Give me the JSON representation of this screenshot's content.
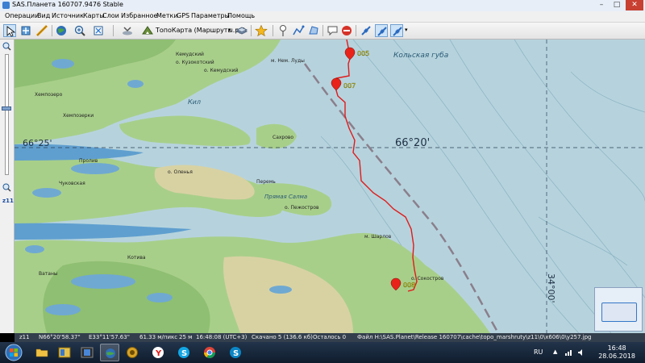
{
  "window": {
    "title": "SAS.Планета 160707.9476 Stable"
  },
  "menu": [
    "Операции",
    "Вид",
    "Источник",
    "Карты",
    "Слои",
    "Избранное",
    "Метки",
    "GPS",
    "Параметры",
    "Помощь"
  ],
  "toolbar": {
    "map_source": "ТопоКарта (Маршруты.ру)"
  },
  "zoom": {
    "label": "z11",
    "level_fraction": 0.45
  },
  "map": {
    "grid_labels": [
      "66°25'",
      "66°20'"
    ],
    "vertical_grid_label": "34°00'",
    "markers": [
      {
        "id": "005",
        "label": "005"
      },
      {
        "id": "007",
        "label": "007"
      },
      {
        "id": "008",
        "label": "008"
      }
    ],
    "place_names": [
      "Кемудский",
      "о. Кузокотский",
      "м. Нем. Луды",
      "Сахрово",
      "о. Кемудский",
      "Кольская губа",
      "Хемпозерки",
      "Пролив",
      "Чуковская",
      "о. Оленья",
      "Прямая Салма",
      "Перемь",
      "о. Пежостров",
      "м. Шарлов",
      "о. Сокостров",
      "Ватаны",
      "Котива",
      "Хемпозеро",
      "Кил"
    ]
  },
  "status": {
    "zoom": "z11",
    "lat": "N66°20'58.37\"",
    "lon": "E33°11'57.63\"",
    "scale": "61.33 м/пикс",
    "dist": "25 м",
    "time": "16:48:08 (UTC+3)",
    "downloaded": "Скачано 5 (136.6 кб)",
    "remaining": "Осталось 0",
    "file": "Файл H:\\SAS.Planet\\Release 160707\\cache\\topo_marshruty\\z11\\0\\x606\\0\\y257.jpg"
  },
  "taskbar": {
    "apps": [
      "explorer",
      "file-manager",
      "media-player",
      "sas-planeta",
      "yandex-browser",
      "skype",
      "chrome",
      "skype-2"
    ],
    "lang": "RU",
    "time": "16:48",
    "date": "28.06.2018"
  },
  "colors": {
    "water": "#b6d3dd",
    "land_green": "#a8cf8a",
    "route": "#e01b1b",
    "marker": "#e8231a",
    "label_yellow": "#f3e21b"
  }
}
